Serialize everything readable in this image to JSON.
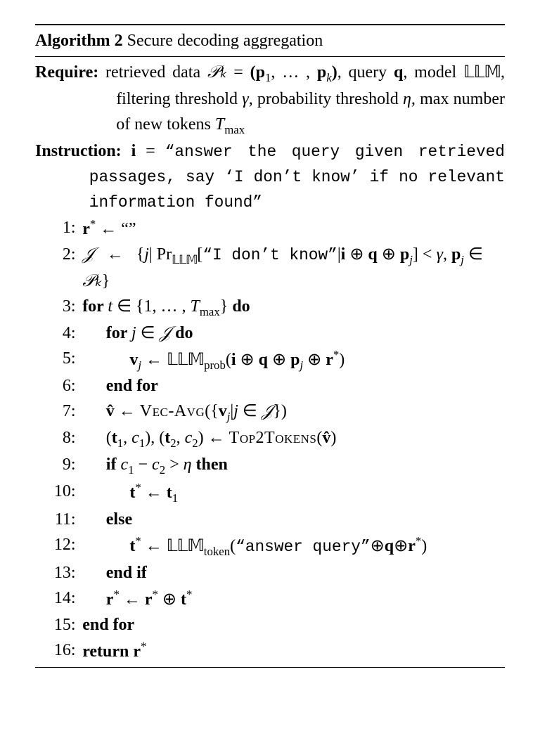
{
  "header": {
    "algo_label": "Algorithm 2",
    "title": "Secure decoding aggregation"
  },
  "require": {
    "label": "Require:",
    "text_prefix": "retrieved data ",
    "Pk": "𝒫ₖ",
    "eq": " = ",
    "tuple": "(p₁, … , pₖ)",
    "query_word": ", query ",
    "q": "q",
    "model_word": ", model ",
    "LLM": "𝕃𝕃𝕄",
    "filter_word": ", filtering threshold ",
    "gamma": "γ",
    "prob_word": ", probability threshold ",
    "eta": "η",
    "max_word": ", max number of new tokens ",
    "Tmax": "Tₘₐₓ"
  },
  "instruction": {
    "label": "Instruction:",
    "ivar": "i",
    "equals": " = ",
    "quote": "“answer the query given retrieved passages, say ‘I don’t know’ if no relevant information found”"
  },
  "steps": {
    "s1": {
      "n": "1:",
      "body_a": "r",
      "body_b": "*",
      "arrow": " ← ",
      "empty": "“”"
    },
    "s2": {
      "n": "2:",
      "J": "𝒥",
      "arrow": " ← ",
      "setopen": "{",
      "jvar": "j",
      "bar": "| ",
      "Pr": "Pr",
      "LLMsub": "𝕃𝕃𝕄",
      "quote": "[“I don’t know”|",
      "i": "i",
      "op": " ⊕ ",
      "q": "q",
      "op2": " ⊕ ",
      "pj": "pⱼ",
      "close1": "]",
      "lt": " < ",
      "gamma": "γ",
      "comma": ", ",
      "pj2": "pⱼ",
      "in": " ∈ ",
      "Pk": "𝒫ₖ",
      "setclose": "}"
    },
    "s3": {
      "n": "3:",
      "for": "for ",
      "t": "t",
      "in": " ∈ ",
      "set": "{1, … , ",
      "Tmax": "Tₘₐₓ",
      "close": "}",
      "do": " do"
    },
    "s4": {
      "n": "4:",
      "for": "for ",
      "j": "j",
      "in": " ∈ ",
      "J": "𝒥",
      "do": " do"
    },
    "s5": {
      "n": "5:",
      "vj": "vⱼ",
      "arrow": " ← ",
      "LLM": "𝕃𝕃𝕄",
      "sub": "prob",
      "open": "(",
      "i": "i",
      "op": " ⊕ ",
      "q": "q",
      "pj": "pⱼ",
      "r": "r",
      "star": "*",
      "close": ")"
    },
    "s6": {
      "n": "6:",
      "endfor": "end for"
    },
    "s7": {
      "n": "7:",
      "vhat": "v̂",
      "arrow": " ← ",
      "fn": "Vec-Avg",
      "open": "({",
      "vj": "vⱼ",
      "bar": "|",
      "j": "j",
      "in": " ∈ ",
      "J": "𝒥",
      "close": "})"
    },
    "s8": {
      "n": "8:",
      "pair1a": "(t₁",
      "c1": ", c₁)",
      "comma": ", ",
      "pair2a": "(t₂",
      "c2": ", c₂)",
      "arrow": " ← ",
      "fn": "Top2Tokens",
      "open": "(",
      "vhat": "v̂",
      "close": ")"
    },
    "s9": {
      "n": "9:",
      "if": "if ",
      "c1": "c₁",
      "minus": " − ",
      "c2": "c₂",
      "gt": " > ",
      "eta": "η",
      "then": " then"
    },
    "s10": {
      "n": "10:",
      "t": "t",
      "star": "*",
      "arrow": " ← ",
      "t1": "t₁"
    },
    "s11": {
      "n": "11:",
      "else": "else"
    },
    "s12": {
      "n": "12:",
      "t": "t",
      "star": "*",
      "arrow": " ← ",
      "LLM": "𝕃𝕃𝕄",
      "sub": "token",
      "open": "(",
      "quote": "“answer query”",
      "op": "⊕",
      "q": "q",
      "r": "r",
      "rstar": "*",
      "close": ")"
    },
    "s13": {
      "n": "13:",
      "endif": "end if"
    },
    "s14": {
      "n": "14:",
      "r": "r",
      "star": "*",
      "arrow": " ← ",
      "r2": "r",
      "star2": "*",
      "op": " ⊕ ",
      "t": "t",
      "tstar": "*"
    },
    "s15": {
      "n": "15:",
      "endfor": "end for"
    },
    "s16": {
      "n": "16:",
      "return": "return ",
      "r": "r",
      "star": "*"
    }
  }
}
